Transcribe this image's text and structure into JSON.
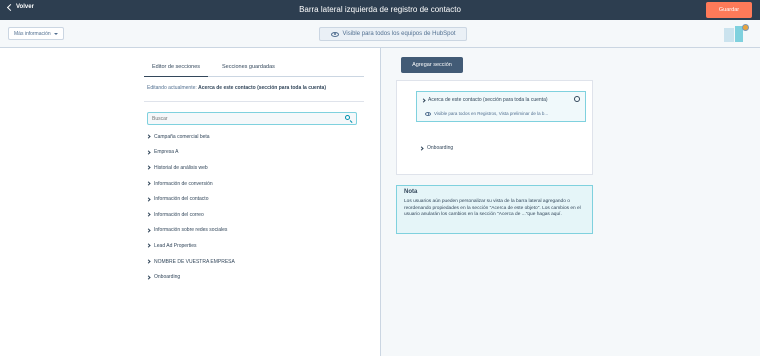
{
  "header": {
    "back_label": "Volver",
    "title": "Barra lateral izquierda de registro de contacto",
    "save_label": "Guardar"
  },
  "toolbar": {
    "more_info_label": "Más información",
    "visibility_label": "Visible para todos los equipos de HubSpot"
  },
  "left_panel": {
    "tabs": [
      {
        "label": "Editor de secciones",
        "active": true
      },
      {
        "label": "Secciones guardadas",
        "active": false
      }
    ],
    "editing_prefix": "Editando actualmente:",
    "editing_value": "Acerca de este contacto (sección para toda la cuenta)",
    "search_placeholder": "Buscar",
    "sections": [
      "Campaña comercial beta",
      "Empresa A",
      "Historial de análisis web",
      "Información de conversión",
      "Información del contacto",
      "Información del correo",
      "Información sobre redes sociales",
      "Lead Ad Properties",
      "NOMBRE DE VUESTRA EMPRESA",
      "Onboarding"
    ]
  },
  "right_panel": {
    "add_section_label": "Agregar sección",
    "selected_section": {
      "title": "Acerca de este contacto (sección para toda la cuenta)",
      "visibility": "Visible para todos en Registros, Vista preliminar de la b..."
    },
    "other_section": "Onboarding",
    "note": {
      "title": "Nota",
      "body": "Los usuarios aún pueden personalizar su vista de la barra lateral agregando o reordenando propiedades en la sección \"Acerca de este objeto\". Los cambios en el usuario anularán los cambios en la sección \"Acerca de ...\"que hagas aquí."
    }
  },
  "colors": {
    "header_bg": "#2d3e50",
    "save_button": "#ff7a59",
    "add_section_button": "#425b76",
    "accent": "#7fd1de",
    "note_bg": "#e5f5f8"
  },
  "icons": [
    "chevron-left-icon",
    "caret-down-icon",
    "eye-icon",
    "search-icon",
    "chevron-right-icon",
    "gear-icon"
  ]
}
